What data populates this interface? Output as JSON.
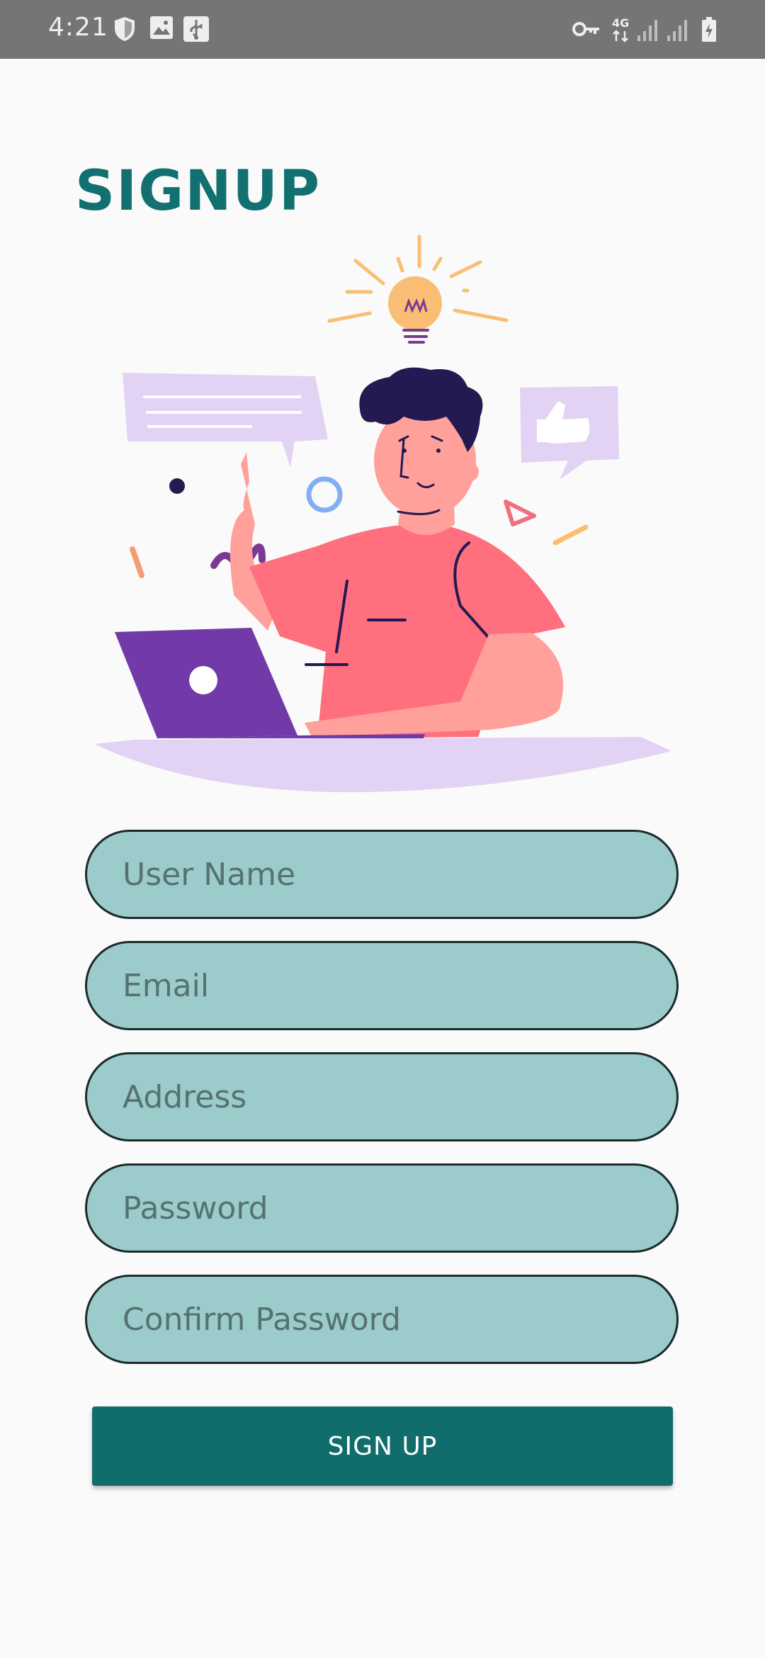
{
  "status_bar": {
    "time": "4:21",
    "icons": [
      "shield-icon",
      "image-icon",
      "usb-icon",
      "key-icon",
      "network-4g-icon",
      "signal-icon",
      "signal-icon-2",
      "battery-icon"
    ],
    "network_label": "4G"
  },
  "page": {
    "title": "SIGNUP"
  },
  "form": {
    "fields": [
      {
        "placeholder": "User Name",
        "value": ""
      },
      {
        "placeholder": "Email",
        "value": ""
      },
      {
        "placeholder": "Address",
        "value": ""
      },
      {
        "placeholder": "Password",
        "value": ""
      },
      {
        "placeholder": "Confirm Password",
        "value": ""
      }
    ],
    "submit_label": "SIGN UP"
  },
  "colors": {
    "status_bar": "#757575",
    "accent": "#137070",
    "field_fill": "#9bcbca",
    "button": "#106d6b",
    "background": "#fafafa"
  }
}
